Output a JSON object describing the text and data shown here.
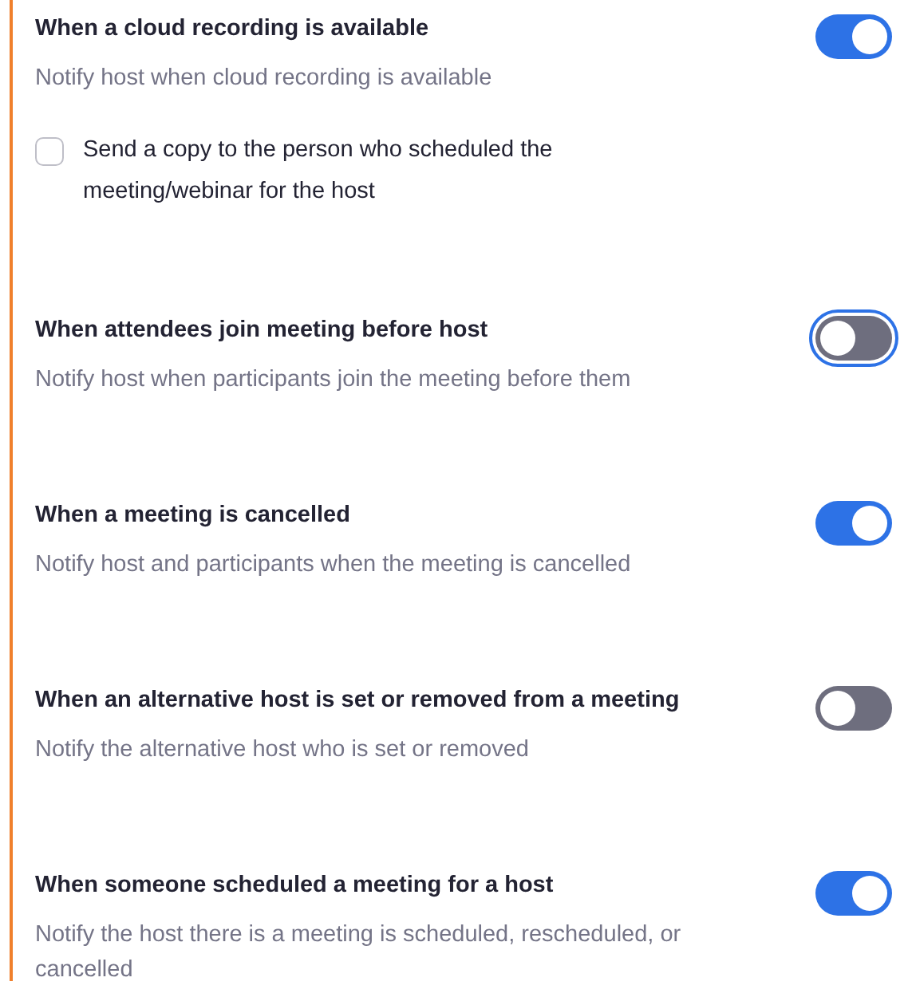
{
  "settings": [
    {
      "title": "When a cloud recording is available",
      "description": "Notify host when cloud recording is available",
      "on": true,
      "focused": false,
      "option": {
        "label": "Send a copy to the person who scheduled the meeting/webinar for the host",
        "checked": false
      }
    },
    {
      "title": "When attendees join meeting before host",
      "description": "Notify host when participants join the meeting before them",
      "on": false,
      "focused": true
    },
    {
      "title": "When a meeting is cancelled",
      "description": "Notify host and participants when the meeting is cancelled",
      "on": true,
      "focused": false
    },
    {
      "title": "When an alternative host is set or removed from a meeting",
      "description": "Notify the alternative host who is set or removed",
      "on": false,
      "focused": false
    },
    {
      "title": "When someone scheduled a meeting for a host",
      "description": "Notify the host there is a meeting is scheduled, rescheduled, or cancelled",
      "on": true,
      "focused": false
    }
  ]
}
